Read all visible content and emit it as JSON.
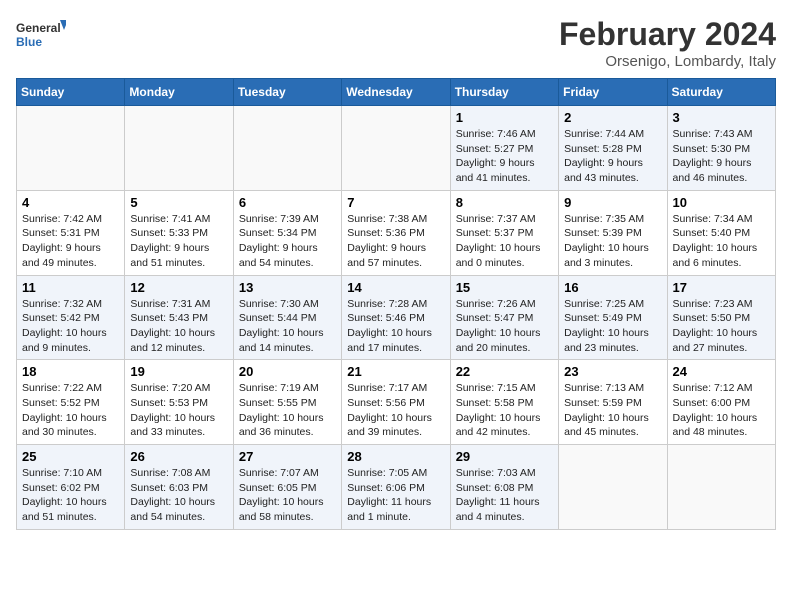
{
  "logo": {
    "text_general": "General",
    "text_blue": "Blue"
  },
  "title": "February 2024",
  "subtitle": "Orsenigo, Lombardy, Italy",
  "headers": [
    "Sunday",
    "Monday",
    "Tuesday",
    "Wednesday",
    "Thursday",
    "Friday",
    "Saturday"
  ],
  "weeks": [
    [
      {
        "day": "",
        "content": ""
      },
      {
        "day": "",
        "content": ""
      },
      {
        "day": "",
        "content": ""
      },
      {
        "day": "",
        "content": ""
      },
      {
        "day": "1",
        "content": "Sunrise: 7:46 AM\nSunset: 5:27 PM\nDaylight: 9 hours\nand 41 minutes."
      },
      {
        "day": "2",
        "content": "Sunrise: 7:44 AM\nSunset: 5:28 PM\nDaylight: 9 hours\nand 43 minutes."
      },
      {
        "day": "3",
        "content": "Sunrise: 7:43 AM\nSunset: 5:30 PM\nDaylight: 9 hours\nand 46 minutes."
      }
    ],
    [
      {
        "day": "4",
        "content": "Sunrise: 7:42 AM\nSunset: 5:31 PM\nDaylight: 9 hours\nand 49 minutes."
      },
      {
        "day": "5",
        "content": "Sunrise: 7:41 AM\nSunset: 5:33 PM\nDaylight: 9 hours\nand 51 minutes."
      },
      {
        "day": "6",
        "content": "Sunrise: 7:39 AM\nSunset: 5:34 PM\nDaylight: 9 hours\nand 54 minutes."
      },
      {
        "day": "7",
        "content": "Sunrise: 7:38 AM\nSunset: 5:36 PM\nDaylight: 9 hours\nand 57 minutes."
      },
      {
        "day": "8",
        "content": "Sunrise: 7:37 AM\nSunset: 5:37 PM\nDaylight: 10 hours\nand 0 minutes."
      },
      {
        "day": "9",
        "content": "Sunrise: 7:35 AM\nSunset: 5:39 PM\nDaylight: 10 hours\nand 3 minutes."
      },
      {
        "day": "10",
        "content": "Sunrise: 7:34 AM\nSunset: 5:40 PM\nDaylight: 10 hours\nand 6 minutes."
      }
    ],
    [
      {
        "day": "11",
        "content": "Sunrise: 7:32 AM\nSunset: 5:42 PM\nDaylight: 10 hours\nand 9 minutes."
      },
      {
        "day": "12",
        "content": "Sunrise: 7:31 AM\nSunset: 5:43 PM\nDaylight: 10 hours\nand 12 minutes."
      },
      {
        "day": "13",
        "content": "Sunrise: 7:30 AM\nSunset: 5:44 PM\nDaylight: 10 hours\nand 14 minutes."
      },
      {
        "day": "14",
        "content": "Sunrise: 7:28 AM\nSunset: 5:46 PM\nDaylight: 10 hours\nand 17 minutes."
      },
      {
        "day": "15",
        "content": "Sunrise: 7:26 AM\nSunset: 5:47 PM\nDaylight: 10 hours\nand 20 minutes."
      },
      {
        "day": "16",
        "content": "Sunrise: 7:25 AM\nSunset: 5:49 PM\nDaylight: 10 hours\nand 23 minutes."
      },
      {
        "day": "17",
        "content": "Sunrise: 7:23 AM\nSunset: 5:50 PM\nDaylight: 10 hours\nand 27 minutes."
      }
    ],
    [
      {
        "day": "18",
        "content": "Sunrise: 7:22 AM\nSunset: 5:52 PM\nDaylight: 10 hours\nand 30 minutes."
      },
      {
        "day": "19",
        "content": "Sunrise: 7:20 AM\nSunset: 5:53 PM\nDaylight: 10 hours\nand 33 minutes."
      },
      {
        "day": "20",
        "content": "Sunrise: 7:19 AM\nSunset: 5:55 PM\nDaylight: 10 hours\nand 36 minutes."
      },
      {
        "day": "21",
        "content": "Sunrise: 7:17 AM\nSunset: 5:56 PM\nDaylight: 10 hours\nand 39 minutes."
      },
      {
        "day": "22",
        "content": "Sunrise: 7:15 AM\nSunset: 5:58 PM\nDaylight: 10 hours\nand 42 minutes."
      },
      {
        "day": "23",
        "content": "Sunrise: 7:13 AM\nSunset: 5:59 PM\nDaylight: 10 hours\nand 45 minutes."
      },
      {
        "day": "24",
        "content": "Sunrise: 7:12 AM\nSunset: 6:00 PM\nDaylight: 10 hours\nand 48 minutes."
      }
    ],
    [
      {
        "day": "25",
        "content": "Sunrise: 7:10 AM\nSunset: 6:02 PM\nDaylight: 10 hours\nand 51 minutes."
      },
      {
        "day": "26",
        "content": "Sunrise: 7:08 AM\nSunset: 6:03 PM\nDaylight: 10 hours\nand 54 minutes."
      },
      {
        "day": "27",
        "content": "Sunrise: 7:07 AM\nSunset: 6:05 PM\nDaylight: 10 hours\nand 58 minutes."
      },
      {
        "day": "28",
        "content": "Sunrise: 7:05 AM\nSunset: 6:06 PM\nDaylight: 11 hours\nand 1 minute."
      },
      {
        "day": "29",
        "content": "Sunrise: 7:03 AM\nSunset: 6:08 PM\nDaylight: 11 hours\nand 4 minutes."
      },
      {
        "day": "",
        "content": ""
      },
      {
        "day": "",
        "content": ""
      }
    ]
  ]
}
